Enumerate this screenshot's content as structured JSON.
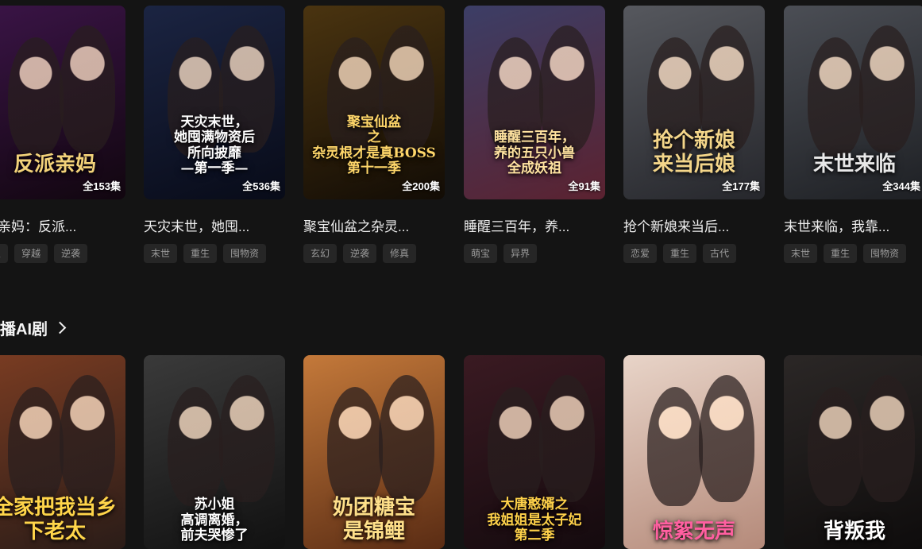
{
  "row1": [
    {
      "poster_text": "反派亲妈",
      "episodes": "全153集",
      "title": "派亲妈：反派...",
      "tags": [
        "宝",
        "穿越",
        "逆袭"
      ],
      "colors": [
        "#3a1446",
        "#11060f"
      ],
      "accent": "#f2d27a"
    },
    {
      "poster_text": "天灾末世，\n她囤满物资后\n所向披靡\n—第一季—",
      "episodes": "全536集",
      "title": "天灾末世，她囤...",
      "tags": [
        "末世",
        "重生",
        "囤物资"
      ],
      "colors": [
        "#1b2442",
        "#080b18"
      ],
      "accent": "#ffffff"
    },
    {
      "poster_text": "聚宝仙盆\n之\n杂灵根才是真BOSS\n第十一季",
      "episodes": "全200集",
      "title": "聚宝仙盆之杂灵...",
      "tags": [
        "玄幻",
        "逆袭",
        "修真"
      ],
      "colors": [
        "#4a3410",
        "#120c05"
      ],
      "accent": "#ffd76a"
    },
    {
      "poster_text": "睡醒三百年，\n养的五只小兽\n全成妖祖",
      "episodes": "全91集",
      "title": "睡醒三百年，养...",
      "tags": [
        "萌宝",
        "异界"
      ],
      "colors": [
        "#3c3e66",
        "#5b2230"
      ],
      "accent": "#ffe3a0"
    },
    {
      "poster_text": "抢个新娘\n来当后娘",
      "episodes": "全177集",
      "title": "抢个新娘来当后...",
      "tags": [
        "恋爱",
        "重生",
        "古代"
      ],
      "colors": [
        "#56585e",
        "#26272c"
      ],
      "accent": "#f4d68a"
    },
    {
      "poster_text": "末世来临",
      "episodes": "全344集",
      "title": "末世来临，我靠...",
      "tags": [
        "末世",
        "重生",
        "囤物资"
      ],
      "colors": [
        "#4b4e55",
        "#1e2024"
      ],
      "accent": "#e8e8e8"
    }
  ],
  "section": {
    "title": "播AI剧"
  },
  "row2": [
    {
      "poster_text": "全家把我当乡下老太",
      "colors": [
        "#7a3c22",
        "#2a1c18"
      ],
      "accent": "#ffd54a"
    },
    {
      "poster_text": "苏小姐\n高调离婚，\n前夫哭惨了",
      "colors": [
        "#3a3a3a",
        "#111111"
      ],
      "accent": "#ffffff"
    },
    {
      "poster_text": "奶团糖宝\n是锦鲤",
      "colors": [
        "#c4793a",
        "#5a2c14"
      ],
      "accent": "#ffe08a"
    },
    {
      "poster_text": "大唐憨婿之\n我姐姐是太子妃\n第二季",
      "colors": [
        "#3a1a22",
        "#140a0e"
      ],
      "accent": "#ffd24a"
    },
    {
      "poster_text": "惊絮无声",
      "colors": [
        "#e8d4c8",
        "#b58a7a"
      ],
      "accent": "#ff5fa0"
    },
    {
      "poster_text": "背叛我",
      "colors": [
        "#2b2726",
        "#0e0c0c"
      ],
      "accent": "#ffffff"
    }
  ]
}
